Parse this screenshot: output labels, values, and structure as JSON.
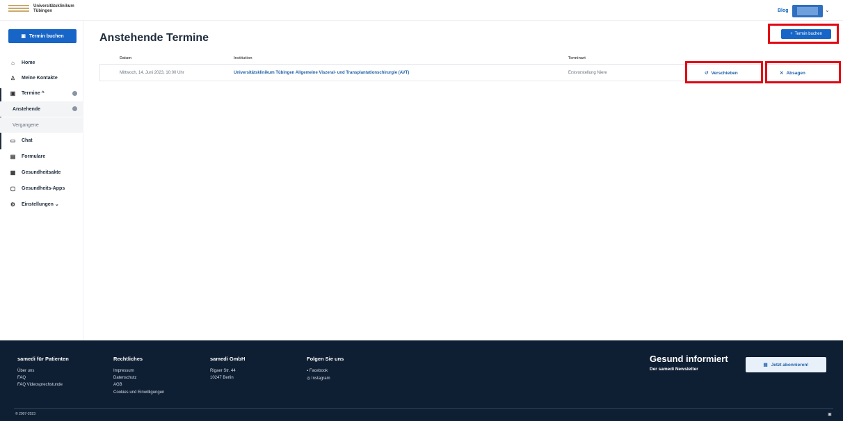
{
  "header": {
    "logo_line1": "Universitätsklinikum",
    "logo_line2": "Tübingen",
    "blog_label": "Blog",
    "user_chevron": "⌄"
  },
  "sidebar": {
    "book_button": "Termin buchen",
    "items": [
      {
        "label": "Home",
        "icon": "home-icon",
        "glyph": "⌂"
      },
      {
        "label": "Meine Kontakte",
        "icon": "contacts-icon",
        "glyph": "♙"
      },
      {
        "label": "Termine ^",
        "icon": "calendar-icon",
        "glyph": "▣"
      },
      {
        "label": "Anstehende"
      },
      {
        "label": "Vergangene"
      },
      {
        "label": "Chat",
        "icon": "chat-icon",
        "glyph": "▭"
      },
      {
        "label": "Formulare",
        "icon": "clipboard-icon",
        "glyph": "▤"
      },
      {
        "label": "Gesundheitsakte",
        "icon": "health-record-icon",
        "glyph": "▦"
      },
      {
        "label": "Gesundheits-Apps",
        "icon": "apps-icon",
        "glyph": "▢"
      },
      {
        "label": "Einstellungen ⌄",
        "icon": "settings-icon",
        "glyph": "⚙"
      }
    ]
  },
  "main": {
    "title": "Anstehende Termine",
    "book_button": "Termin buchen",
    "columns": {
      "date": "Datum",
      "institution": "Institution",
      "type": "Terminart"
    },
    "appointment": {
      "date": "Mittwoch, 14. Juni 2023, 10:00 Uhr",
      "institution": "Universitätsklinikum Tübingen Allgemeine Viszeral- und Transplantationschirurgie (AVT)",
      "type": "Erstvorstellung Niere",
      "reschedule_label": "Verschieben",
      "cancel_label": "Absagen"
    }
  },
  "footer": {
    "col1_title": "samedi für Patienten",
    "col1_links": [
      "Über uns",
      "FAQ",
      "FAQ Videosprechstunde"
    ],
    "col2_title": "Rechtliches",
    "col2_links": [
      "Impressum",
      "Datenschutz",
      "AGB",
      "Cookies und Einwilligungen"
    ],
    "col3_title": "samedi GmbH",
    "col3_lines": [
      "Rigaer Str. 44",
      "10247 Berlin"
    ],
    "col4_title": "Folgen Sie uns",
    "col4_links": [
      "Facebook",
      "Instagram"
    ],
    "newsletter_title": "Gesund informiert",
    "newsletter_sub": "Der samedi Newsletter",
    "newsletter_button": "Jetzt abonnieren!",
    "copyright": "© 2007-2023"
  },
  "colors": {
    "primary": "#1765c6",
    "highlight": "#e30613",
    "footer_bg": "#0e1e33"
  }
}
